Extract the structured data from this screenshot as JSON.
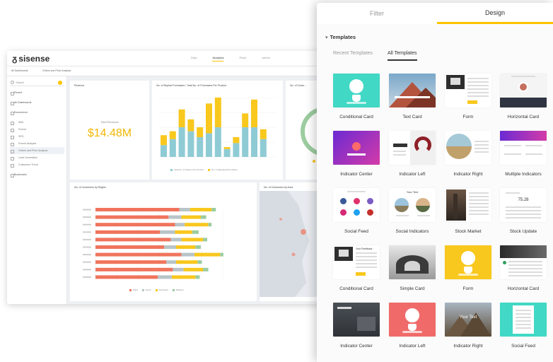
{
  "dashboard": {
    "logo": "sisense",
    "nav": [
      "Data",
      "Analytics",
      "Pulse",
      "Admin"
    ],
    "breadcrumb": [
      "All Dashboards",
      "Orders and Price Analysis"
    ],
    "sidebar": {
      "search_placeholder": "Search",
      "items": [
        {
          "label": "Recent",
          "sub": false
        },
        {
          "label": "All Dashboards",
          "sub": false
        },
        {
          "label": "Ecommerce",
          "sub": false
        },
        {
          "label": "Web",
          "sub": true
        },
        {
          "label": "Funnel",
          "sub": true
        },
        {
          "label": "SEO",
          "sub": true
        },
        {
          "label": "Funnel Analysis",
          "sub": true
        },
        {
          "label": "Orders and Price Analysis",
          "sub": true,
          "active": true
        },
        {
          "label": "Lead Generation",
          "sub": true
        },
        {
          "label": "Customers Trend",
          "sub": true
        },
        {
          "label": "Bookmarks",
          "sub": false
        }
      ]
    },
    "kpi": {
      "title": "Revenue",
      "label": "Total Revenue",
      "value": "$14.48M"
    },
    "bar_card_title": "No. of Repeat Purchases / Total No. of Purchases Per Product",
    "bar_legend": [
      "Total No. of Orders Per Product",
      "No. of Repeated Purchases"
    ],
    "donut_title": "No. of Custo...",
    "hbar_title": "No. of Customers by Region",
    "hbar_legend": [
      "West",
      "South",
      "Northeast",
      "Midwest"
    ],
    "map_title": "No. of Customers by Area",
    "colors": {
      "teal": "#8fcbd4",
      "yellow": "#f9c81e",
      "coral": "#f0745c",
      "orange": "#f9c81e",
      "gray": "#b8c4c8",
      "green": "#9ccc9f"
    }
  },
  "chart_data": [
    {
      "type": "bar",
      "series": [
        {
          "name": "Total No. of Orders Per Product",
          "values": [
            12,
            18,
            30,
            26,
            20,
            24,
            30,
            8,
            14,
            30,
            30,
            18
          ]
        },
        {
          "name": "No. of Repeated Purchases",
          "values": [
            10,
            8,
            18,
            12,
            10,
            30,
            30,
            2,
            6,
            14,
            28,
            10
          ]
        }
      ]
    },
    {
      "type": "bar",
      "series": [
        {
          "name": "West",
          "values": [
            78,
            68,
            74,
            60,
            70,
            64,
            80,
            66,
            72,
            58
          ]
        },
        {
          "name": "South",
          "values": [
            10,
            12,
            9,
            14,
            10,
            11,
            12,
            9,
            10,
            13
          ]
        },
        {
          "name": "Northeast",
          "values": [
            20,
            18,
            22,
            16,
            20,
            18,
            24,
            20,
            18,
            22
          ]
        },
        {
          "name": "Midwest",
          "values": [
            4,
            5,
            3,
            6,
            4,
            5,
            3,
            4,
            5,
            4
          ]
        }
      ]
    }
  ],
  "panel": {
    "tabs": {
      "filter": "Filter",
      "design": "Design"
    },
    "section": "Templates",
    "subtabs": {
      "recent": "Recent Templates",
      "all": "All Templates"
    },
    "templates": [
      {
        "label": "Conditional Card",
        "thumb": "teal-dog"
      },
      {
        "label": "Text Card",
        "thumb": "mountain"
      },
      {
        "label": "Form",
        "thumb": "form"
      },
      {
        "label": "Horizontal Card",
        "thumb": "profile"
      },
      {
        "label": "Indicator Center",
        "thumb": "purple"
      },
      {
        "label": "Indicator Left",
        "thumb": "headphones"
      },
      {
        "label": "Indicator Right",
        "thumb": "landscape"
      },
      {
        "label": "Multiple Indicators",
        "thumb": "multi"
      },
      {
        "label": "Social Feed",
        "thumb": "social"
      },
      {
        "label": "Social Indicators",
        "thumb": "your-text"
      },
      {
        "label": "Stock Market",
        "thumb": "stock"
      },
      {
        "label": "Stock Update",
        "thumb": "update"
      },
      {
        "label": "Conditional Card",
        "thumb": "form2"
      },
      {
        "label": "Simple Card",
        "thumb": "bw"
      },
      {
        "label": "Form",
        "thumb": "yellow-dog"
      },
      {
        "label": "Horizontal Card",
        "thumb": "dark-list"
      },
      {
        "label": "Indicator Center",
        "thumb": "dark-room"
      },
      {
        "label": "Indicator Left",
        "thumb": "coral-dog"
      },
      {
        "label": "Indicator Right",
        "thumb": "your-text-valley"
      },
      {
        "label": "Social Feed",
        "thumb": "teal-feed"
      }
    ],
    "thumb_texts": {
      "your_text": "Your Text",
      "your_feedback": "Your Feedback"
    }
  }
}
